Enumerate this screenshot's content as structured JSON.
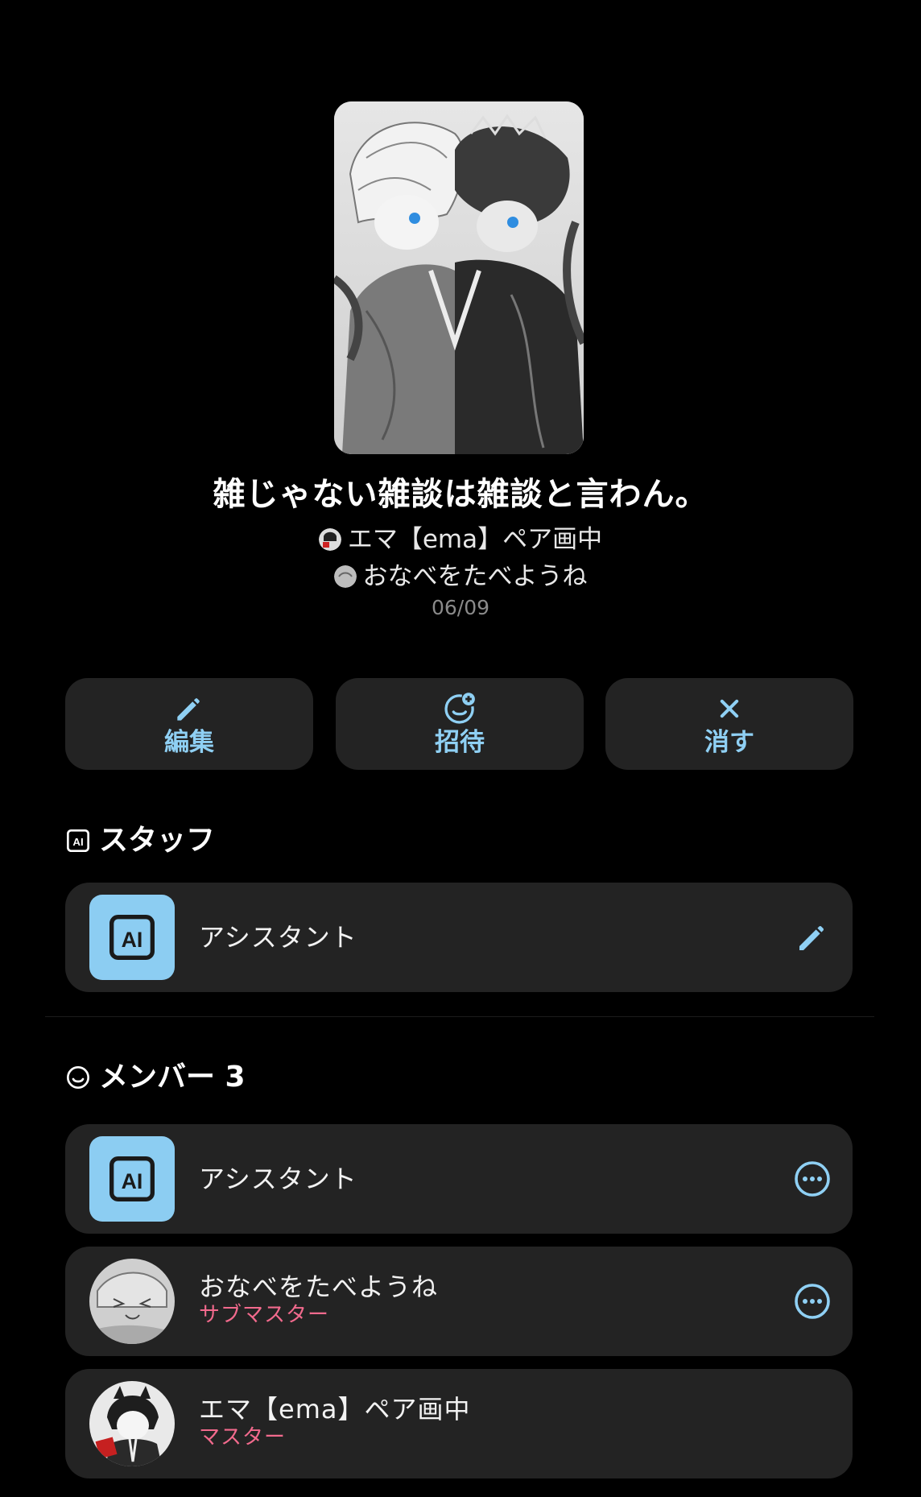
{
  "room": {
    "title": "雑じゃない雑談は雑談と言わん。",
    "host_primary": "エマ【ema】ペア画中",
    "host_secondary": "おなべをたべようね",
    "date": "06/09"
  },
  "actions": {
    "edit_label": "編集",
    "invite_label": "招待",
    "delete_label": "消す"
  },
  "staff": {
    "heading": "スタッフ",
    "items": [
      {
        "name": "アシスタント"
      }
    ]
  },
  "members": {
    "heading": "メンバー 3",
    "items": [
      {
        "name": "アシスタント",
        "role": ""
      },
      {
        "name": "おなべをたべようね",
        "role": "サブマスター"
      },
      {
        "name": "エマ【ema】ペア画中",
        "role": "マスター"
      }
    ]
  },
  "colors": {
    "background": "#000000",
    "card": "#232323",
    "accent": "#8fd0f4",
    "role": "#f26a8d",
    "ai_badge": "#8ccdf2"
  },
  "icons": {
    "edit": "pencil-icon",
    "invite": "add-user-icon",
    "delete": "close-icon",
    "staff": "ai-icon",
    "members": "smiley-icon",
    "more": "more-icon"
  }
}
